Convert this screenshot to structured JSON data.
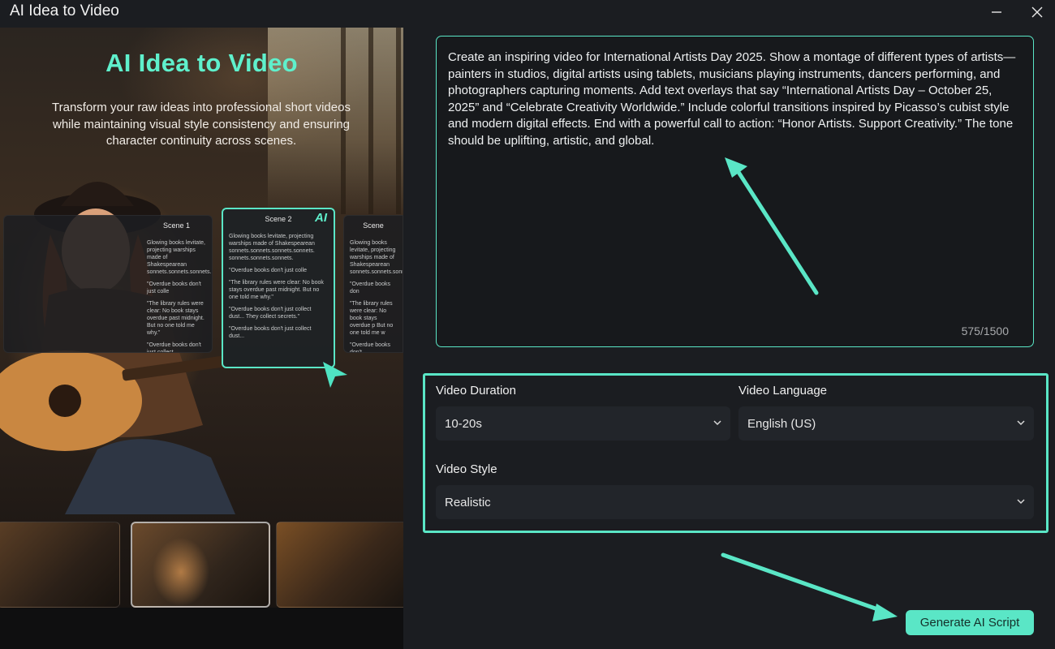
{
  "window": {
    "title": "AI Idea to Video",
    "minimize_icon": "minimize-icon",
    "close_icon": "close-icon"
  },
  "promo": {
    "title": "AI Idea to Video",
    "description": "Transform your raw ideas into professional short videos while maintaining visual style consistency and ensuring character continuity across scenes.",
    "cards": [
      {
        "title": "Scene 1",
        "lines": [
          "Glowing books levitate, projecting warships made of Shakespearean sonnets.sonnets.sonnets.",
          "\"Overdue books don't just colle",
          "\"The library rules were clear: No book stays overdue past midnight. But no one told me why.\"",
          "\"Overdue books don't just collect"
        ]
      },
      {
        "title": "Scene 2",
        "badge": "AI",
        "lines": [
          "Glowing books levitate, projecting warships made of Shakespearean sonnets.sonnets.sonnets.sonnets. sonnets.sonnets.sonnets.",
          "\"Overdue books don't just colle",
          "\"The library rules were clear: No book stays overdue past midnight. But no one told me why.\"",
          "\"Overdue books don't just collect dust... They collect secrets.\"",
          "\"Overdue books don't just collect dust..."
        ]
      },
      {
        "title": "Scene",
        "lines": [
          "Glowing books levitate, projecting warships made of Shakespearean sonnets.sonnets.sonnets.",
          "\"Overdue books don",
          "\"The library rules were clear: No book stays overdue p But no one told me w",
          "\"Overdue books don't"
        ]
      }
    ]
  },
  "prompt": {
    "text": "Create an inspiring video for International Artists Day 2025. Show a montage of different types of artists—painters in studios, digital artists using tablets, musicians playing instruments, dancers performing, and photographers capturing moments. Add text overlays that say “International Artists Day – October 25, 2025” and “Celebrate Creativity Worldwide.” Include colorful transitions inspired by Picasso’s cubist style and modern digital effects. End with a powerful call to action: “Honor Artists. Support Creativity.” The tone should be uplifting, artistic, and global.",
    "char_count": "575/1500"
  },
  "settings": {
    "duration": {
      "label": "Video Duration",
      "value": "10-20s"
    },
    "language": {
      "label": "Video Language",
      "value": "English (US)"
    },
    "style": {
      "label": "Video Style",
      "value": "Realistic"
    }
  },
  "actions": {
    "generate_label": "Generate AI Script"
  },
  "colors": {
    "accent": "#5ae6c6",
    "background": "#1b1d21",
    "field": "#22252a"
  }
}
